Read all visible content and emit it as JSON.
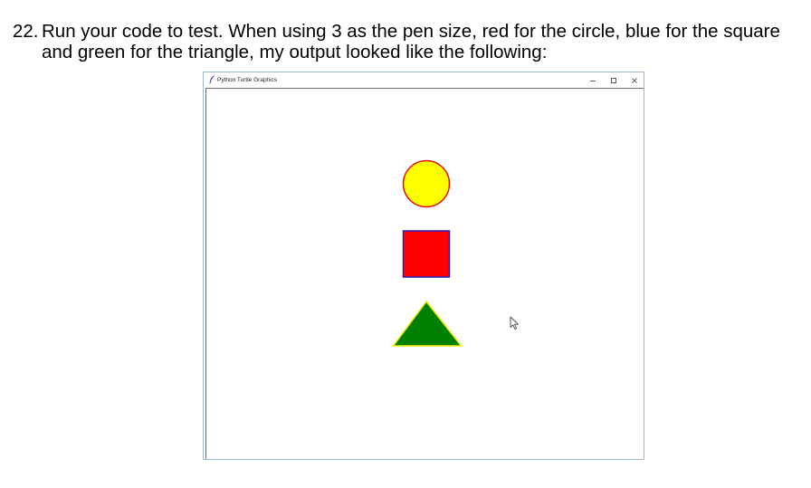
{
  "instruction": {
    "number": "22.",
    "text": "Run your code to test.  When using 3 as the pen size, red for the circle, blue for the square and green for the triangle, my output looked like the following:"
  },
  "window": {
    "title": "Python Turtle Graphics",
    "controls": [
      "minimize-icon",
      "maximize-icon",
      "close-icon"
    ]
  },
  "drawing": {
    "pen_size": 3,
    "background": "#ffffff",
    "circle": {
      "fill": "#ffff00",
      "pen": "#e01010"
    },
    "square": {
      "fill": "#ff0000",
      "pen": "#2020c0"
    },
    "triangle": {
      "fill": "#008000",
      "pen": "#f0f000"
    }
  },
  "icons": {
    "app": "feather-icon",
    "pointer": "mouse-pointer-icon"
  }
}
